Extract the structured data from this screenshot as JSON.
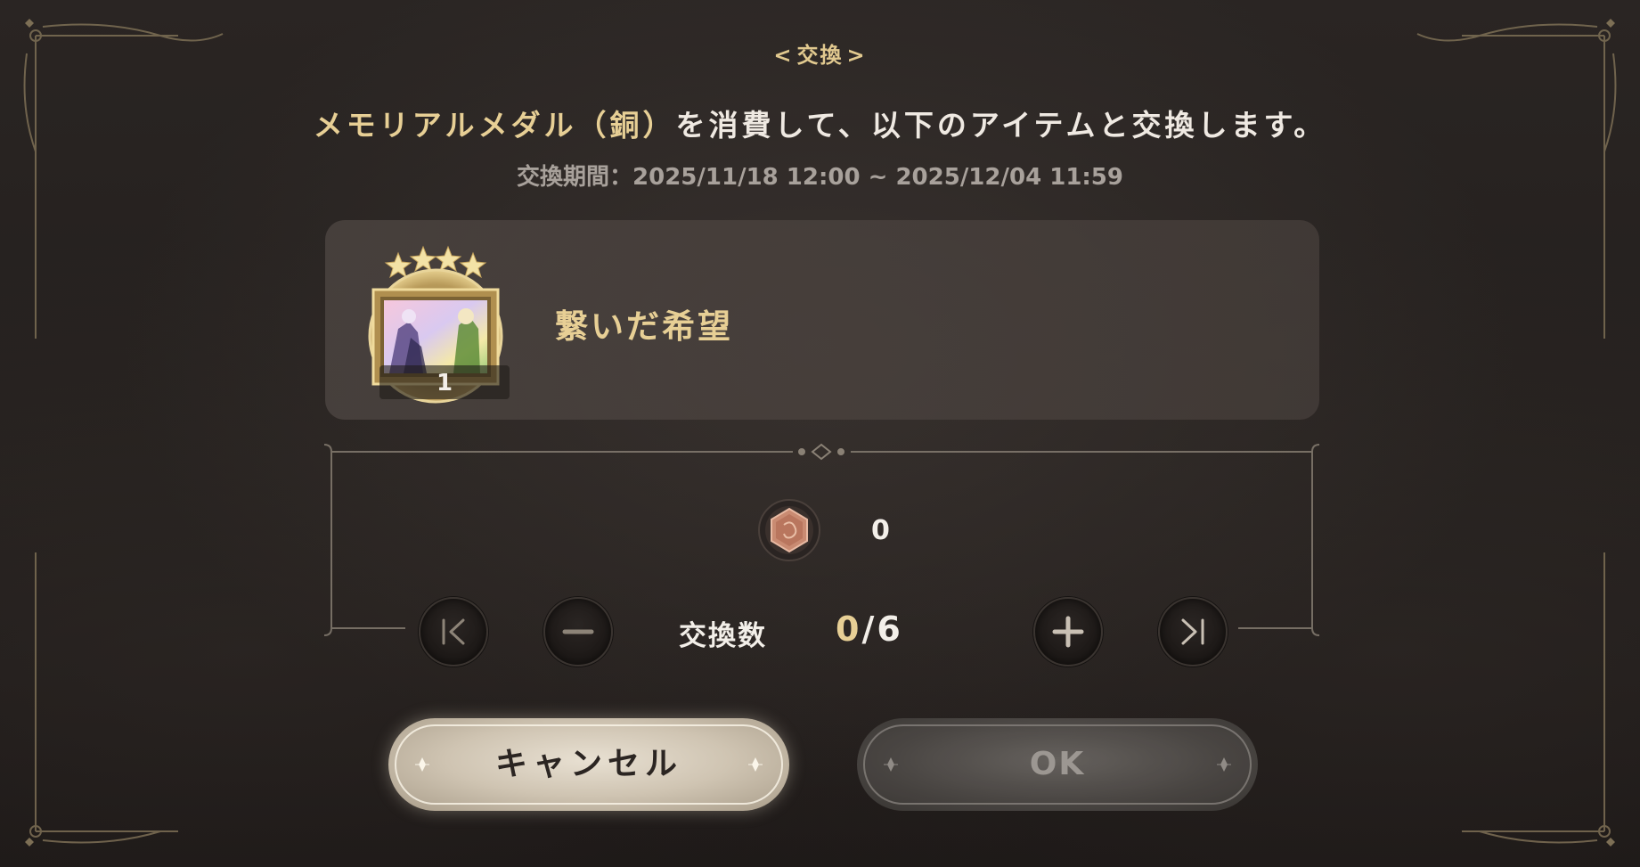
{
  "dialog": {
    "header": "交換",
    "message_accent": "メモリアルメダル（銅）",
    "message_rest": "を消費して、以下のアイテムと交換します。",
    "period_label": "交換期間：",
    "period_value": "2025/11/18 12:00 ~ 2025/12/04 11:59"
  },
  "item": {
    "name": "繋いだ希望",
    "count": "1",
    "rarity_stars": 4,
    "icon": "framed-artwork-icon"
  },
  "cost": {
    "icon": "bronze-medal-icon",
    "amount": "0"
  },
  "quantity": {
    "label": "交換数",
    "current": "0",
    "separator": "/",
    "max": "6"
  },
  "buttons": {
    "cancel": "キャンセル",
    "ok": "OK"
  },
  "colors": {
    "accent_gold": "#e7cf95",
    "text_light": "#f3efe9",
    "text_muted": "#a8a19b",
    "frame_gold": "#8a7a5a",
    "medal_copper": "#c98b72"
  }
}
